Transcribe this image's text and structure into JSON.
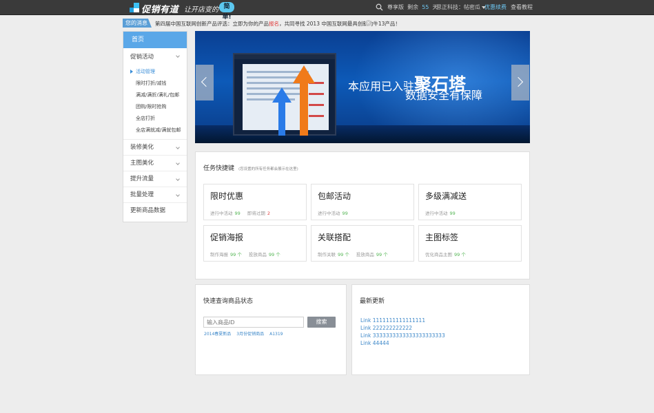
{
  "topbar": {
    "brand": "促销有道",
    "slogan": "让开店变的",
    "slogan_badge": "简单!",
    "edition": "尊享版",
    "remaining_label": "剩余",
    "remaining_days": "55",
    "days_unit": "天",
    "user": "思正科技：帖密瓜",
    "discount": "优惠续费",
    "tutorial": "查看教程"
  },
  "notice": {
    "tag": "您的消息",
    "text_before": "第四届中国互联网创新产品评选：立即为你的产品",
    "text_highlight": "报名",
    "text_after": "，共同寻找 2013 中国互联网最具创新的牛13产品！",
    "close": "×"
  },
  "sidebar": {
    "home": "首页",
    "promo": "促销活动",
    "subs": [
      "活动管理",
      "限时打折/减钱",
      "满减/满折/满礼/包邮",
      "团购/限时抢购",
      "全店打折",
      "全店满就减/满就包邮"
    ],
    "groups": [
      "装修美化",
      "主图美化",
      "提升流量",
      "批量处理"
    ],
    "update_data": "更新商品数据"
  },
  "banner": {
    "line1_prefix": "本应用已入驻",
    "line1_big": "聚石塔",
    "line2": "数据安全有保障"
  },
  "tasks": {
    "title": "任务快捷键",
    "hint": "(您设置的所有任务都会展示在这里)",
    "cards": [
      {
        "name": "限时优惠",
        "s1_label": "进行中活动",
        "s1_value": "99",
        "s2_label": "即将过期",
        "s2_value": "2"
      },
      {
        "name": "包邮活动",
        "s1_label": "进行中活动",
        "s1_value": "99"
      },
      {
        "name": "多级满减送",
        "s1_label": "进行中活动",
        "s1_value": "99"
      },
      {
        "name": "促销海报",
        "s1_label": "制作海报",
        "s1_value": "99 个",
        "s2_label": "投放商品",
        "s2_value": "99 个"
      },
      {
        "name": "关联搭配",
        "s1_label": "制作关联",
        "s1_value": "99 个",
        "s2_label": "投放商品",
        "s2_value": "99 个"
      },
      {
        "name": "主图标签",
        "s1_label": "优化商品主图",
        "s1_value": "99 个"
      }
    ]
  },
  "query": {
    "title": "快速查询商品状态",
    "placeholder": "输入商品ID",
    "button": "搜索",
    "links": [
      "2014春夏新品",
      "3月份促销商品",
      "A1319"
    ]
  },
  "updates": {
    "title": "最新更新",
    "links": [
      "Link 1111111111111111",
      "Link 222222222222",
      "Link 3333333333333333333333",
      "Link 44444"
    ]
  },
  "colors": {
    "accent": "#5aa7e8",
    "link": "#3a86c8",
    "topbar": "#3a3a3a",
    "positive": "#53b553",
    "warning": "#e04040"
  }
}
